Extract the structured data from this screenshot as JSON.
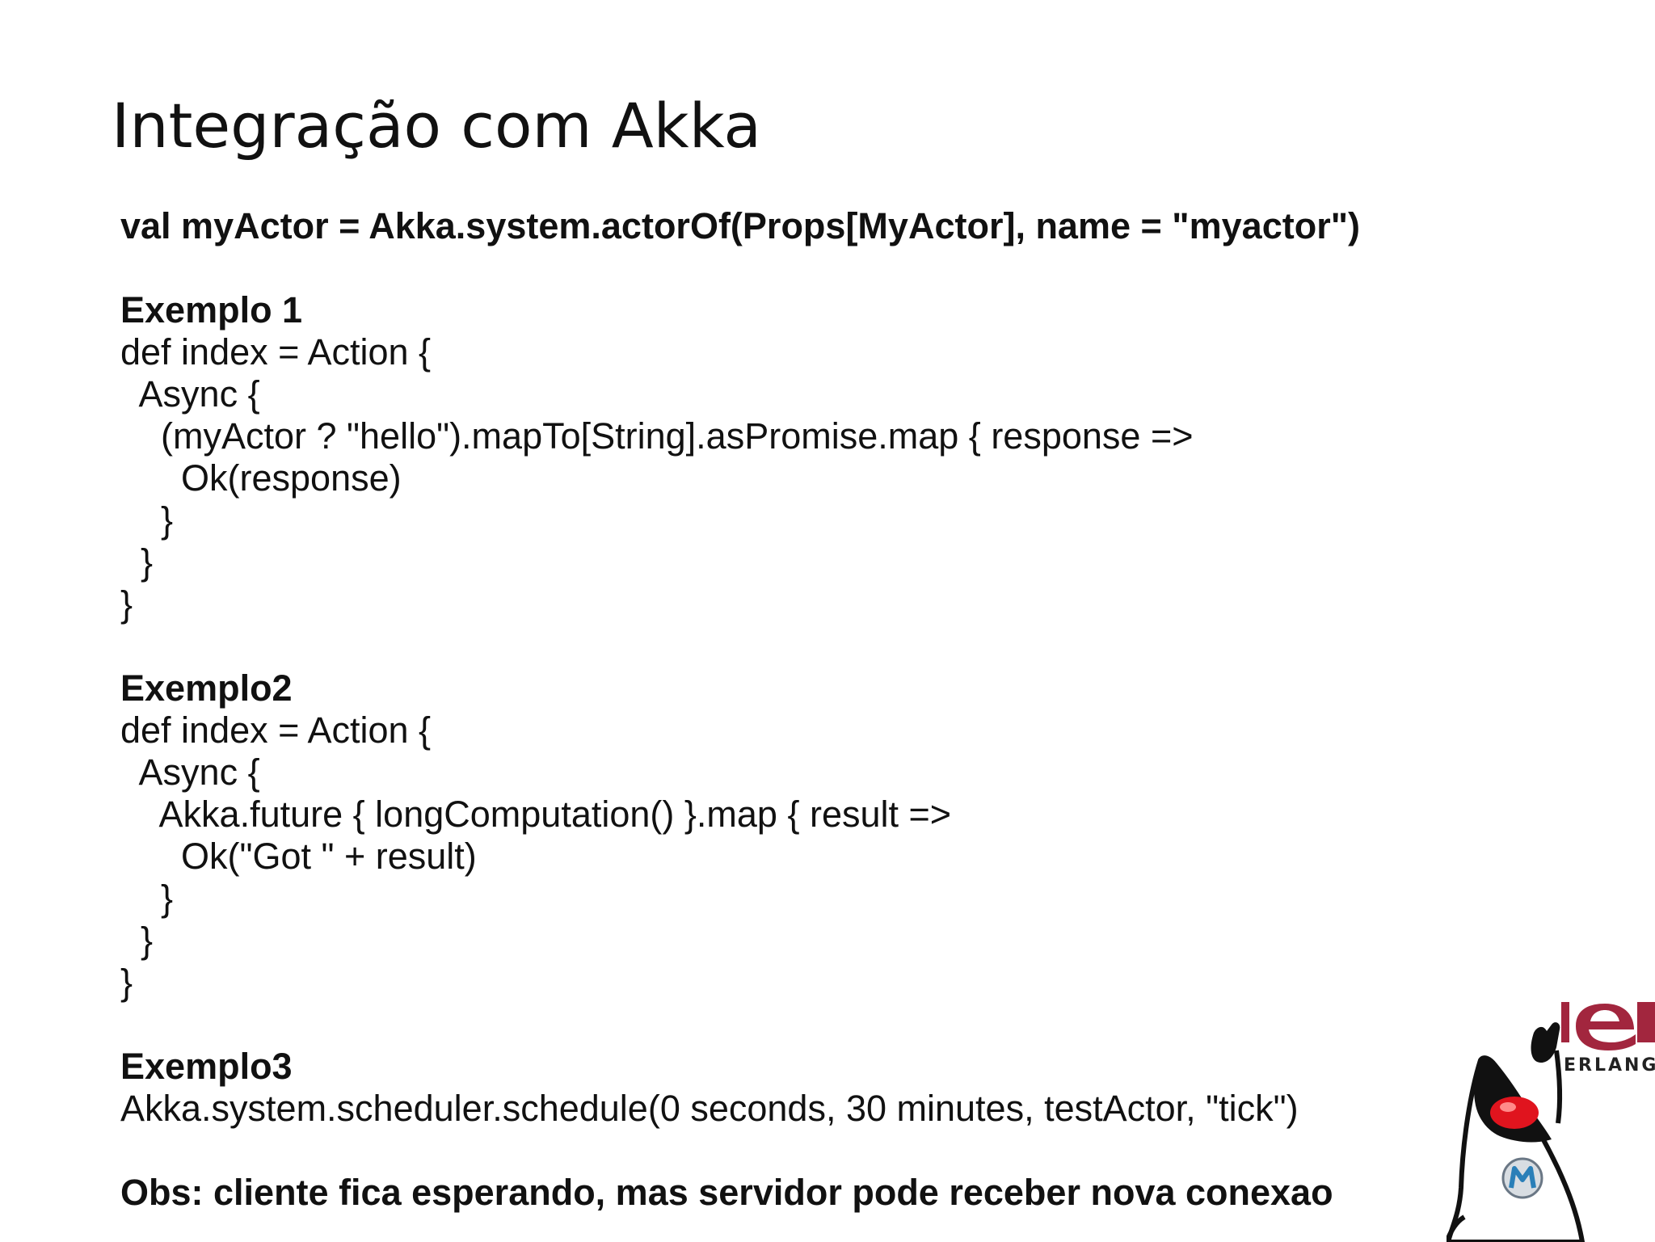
{
  "slide": {
    "title": "Integração com Akka",
    "lines": [
      {
        "text": "val myActor = Akka.system.actorOf(Props[MyActor], name = \"myactor\")",
        "bold": true
      },
      {
        "text": "",
        "bold": false
      },
      {
        "text": "Exemplo 1",
        "bold": true
      },
      {
        "text": "def index = Action {",
        "bold": false
      },
      {
        "text": "  Async {",
        "bold": false
      },
      {
        "text": "    (myActor ? \"hello\").mapTo[String].asPromise.map { response =>",
        "bold": false
      },
      {
        "text": "      Ok(response)",
        "bold": false
      },
      {
        "text": "    }",
        "bold": false
      },
      {
        "text": "  }",
        "bold": false
      },
      {
        "text": "}",
        "bold": false
      },
      {
        "text": "",
        "bold": false
      },
      {
        "text": "Exemplo2",
        "bold": true
      },
      {
        "text": "def index = Action {",
        "bold": false
      },
      {
        "text": "  Async {",
        "bold": false
      },
      {
        "text": "    Akka.future { longComputation() }.map { result =>",
        "bold": false
      },
      {
        "text": "      Ok(\"Got \" + result)",
        "bold": false
      },
      {
        "text": "    }",
        "bold": false
      },
      {
        "text": "  }",
        "bold": false
      },
      {
        "text": "}",
        "bold": false
      },
      {
        "text": "",
        "bold": false
      },
      {
        "text": "Exemplo3",
        "bold": true
      },
      {
        "text": "Akka.system.scheduler.schedule(0 seconds, 30 minutes, testActor, \"tick\")",
        "bold": false
      },
      {
        "text": "",
        "bold": false
      },
      {
        "text": "Obs: cliente fica esperando, mas servidor pode receber nova conexao",
        "bold": true
      }
    ]
  },
  "logo": {
    "erlang_text": "ERLANG",
    "erlang_color": "#a2263e",
    "duke_nose_color": "#e0141e",
    "badge_color": "#2a7fb8"
  }
}
